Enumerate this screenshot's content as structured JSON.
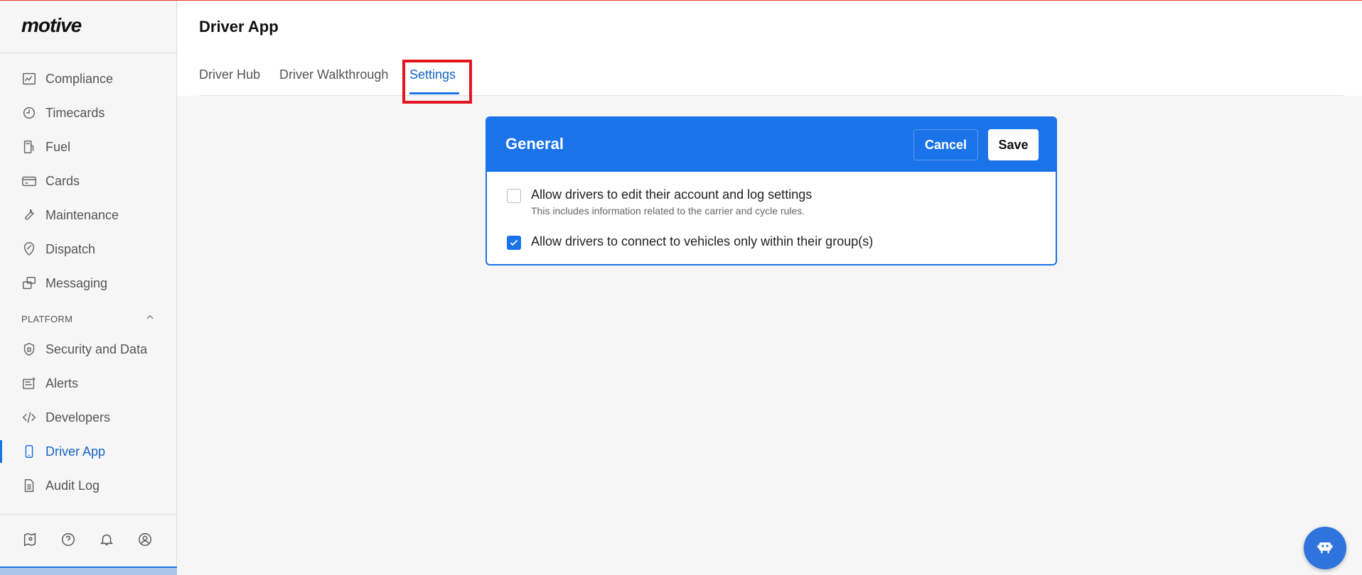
{
  "app": {
    "logo_text": "motive"
  },
  "sidebar": {
    "items": [
      {
        "label": "Compliance",
        "icon": "compliance-icon"
      },
      {
        "label": "Timecards",
        "icon": "clock-icon"
      },
      {
        "label": "Fuel",
        "icon": "fuel-icon"
      },
      {
        "label": "Cards",
        "icon": "card-icon"
      },
      {
        "label": "Maintenance",
        "icon": "wrench-icon"
      },
      {
        "label": "Dispatch",
        "icon": "dispatch-icon"
      },
      {
        "label": "Messaging",
        "icon": "messaging-icon"
      }
    ],
    "platform_section": {
      "label": "PLATFORM",
      "items": [
        {
          "label": "Security and Data",
          "icon": "shield-icon"
        },
        {
          "label": "Alerts",
          "icon": "alerts-icon"
        },
        {
          "label": "Developers",
          "icon": "code-icon"
        },
        {
          "label": "Driver App",
          "icon": "phone-icon",
          "active": true
        },
        {
          "label": "Audit Log",
          "icon": "document-icon"
        }
      ]
    },
    "bottom_icons": [
      "map-pin-icon",
      "help-icon",
      "bell-icon",
      "user-icon"
    ]
  },
  "header": {
    "title": "Driver App",
    "tabs": [
      {
        "label": "Driver Hub"
      },
      {
        "label": "Driver Walkthrough"
      },
      {
        "label": "Settings",
        "active": true
      }
    ]
  },
  "card": {
    "title": "General",
    "cancel_label": "Cancel",
    "save_label": "Save",
    "options": [
      {
        "label": "Allow drivers to edit their account and log settings",
        "help": "This includes information related to the carrier and cycle rules.",
        "checked": false
      },
      {
        "label": "Allow drivers to connect to vehicles only within their group(s)",
        "checked": true
      }
    ]
  },
  "colors": {
    "accent": "#1a73e8",
    "highlight": "#e5151f",
    "active_text": "#1565c0"
  }
}
